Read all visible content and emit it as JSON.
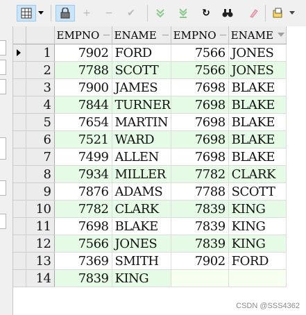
{
  "toolbar": {
    "icons": [
      "grid-view-icon",
      "dropdown-arrow-icon",
      "lock-icon",
      "add-record-icon",
      "delete-record-icon",
      "post-changes-icon",
      "fetch-next-icon",
      "fetch-last-icon",
      "refresh-icon",
      "find-icon",
      "clear-icon",
      "export-icon"
    ]
  },
  "grid": {
    "columns": [
      "EMPNO",
      "ENAME",
      "EMPNO",
      "ENAME"
    ],
    "rows": [
      {
        "n": "1",
        "c": [
          "7902",
          "FORD",
          "7566",
          "JONES"
        ]
      },
      {
        "n": "2",
        "c": [
          "7788",
          "SCOTT",
          "7566",
          "JONES"
        ]
      },
      {
        "n": "3",
        "c": [
          "7900",
          "JAMES",
          "7698",
          "BLAKE"
        ]
      },
      {
        "n": "4",
        "c": [
          "7844",
          "TURNER",
          "7698",
          "BLAKE"
        ]
      },
      {
        "n": "5",
        "c": [
          "7654",
          "MARTIN",
          "7698",
          "BLAKE"
        ]
      },
      {
        "n": "6",
        "c": [
          "7521",
          "WARD",
          "7698",
          "BLAKE"
        ]
      },
      {
        "n": "7",
        "c": [
          "7499",
          "ALLEN",
          "7698",
          "BLAKE"
        ]
      },
      {
        "n": "8",
        "c": [
          "7934",
          "MILLER",
          "7782",
          "CLARK"
        ]
      },
      {
        "n": "9",
        "c": [
          "7876",
          "ADAMS",
          "7788",
          "SCOTT"
        ]
      },
      {
        "n": "10",
        "c": [
          "7782",
          "CLARK",
          "7839",
          "KING"
        ]
      },
      {
        "n": "11",
        "c": [
          "7698",
          "BLAKE",
          "7839",
          "KING"
        ]
      },
      {
        "n": "12",
        "c": [
          "7566",
          "JONES",
          "7839",
          "KING"
        ]
      },
      {
        "n": "13",
        "c": [
          "7369",
          "SMITH",
          "7902",
          "FORD"
        ]
      },
      {
        "n": "14",
        "c": [
          "7839",
          "KING",
          "",
          ""
        ]
      }
    ]
  },
  "watermark": "CSDN @SSS4362",
  "colors": {
    "alt_row": "#e6fbe6",
    "header": "#ececec"
  }
}
